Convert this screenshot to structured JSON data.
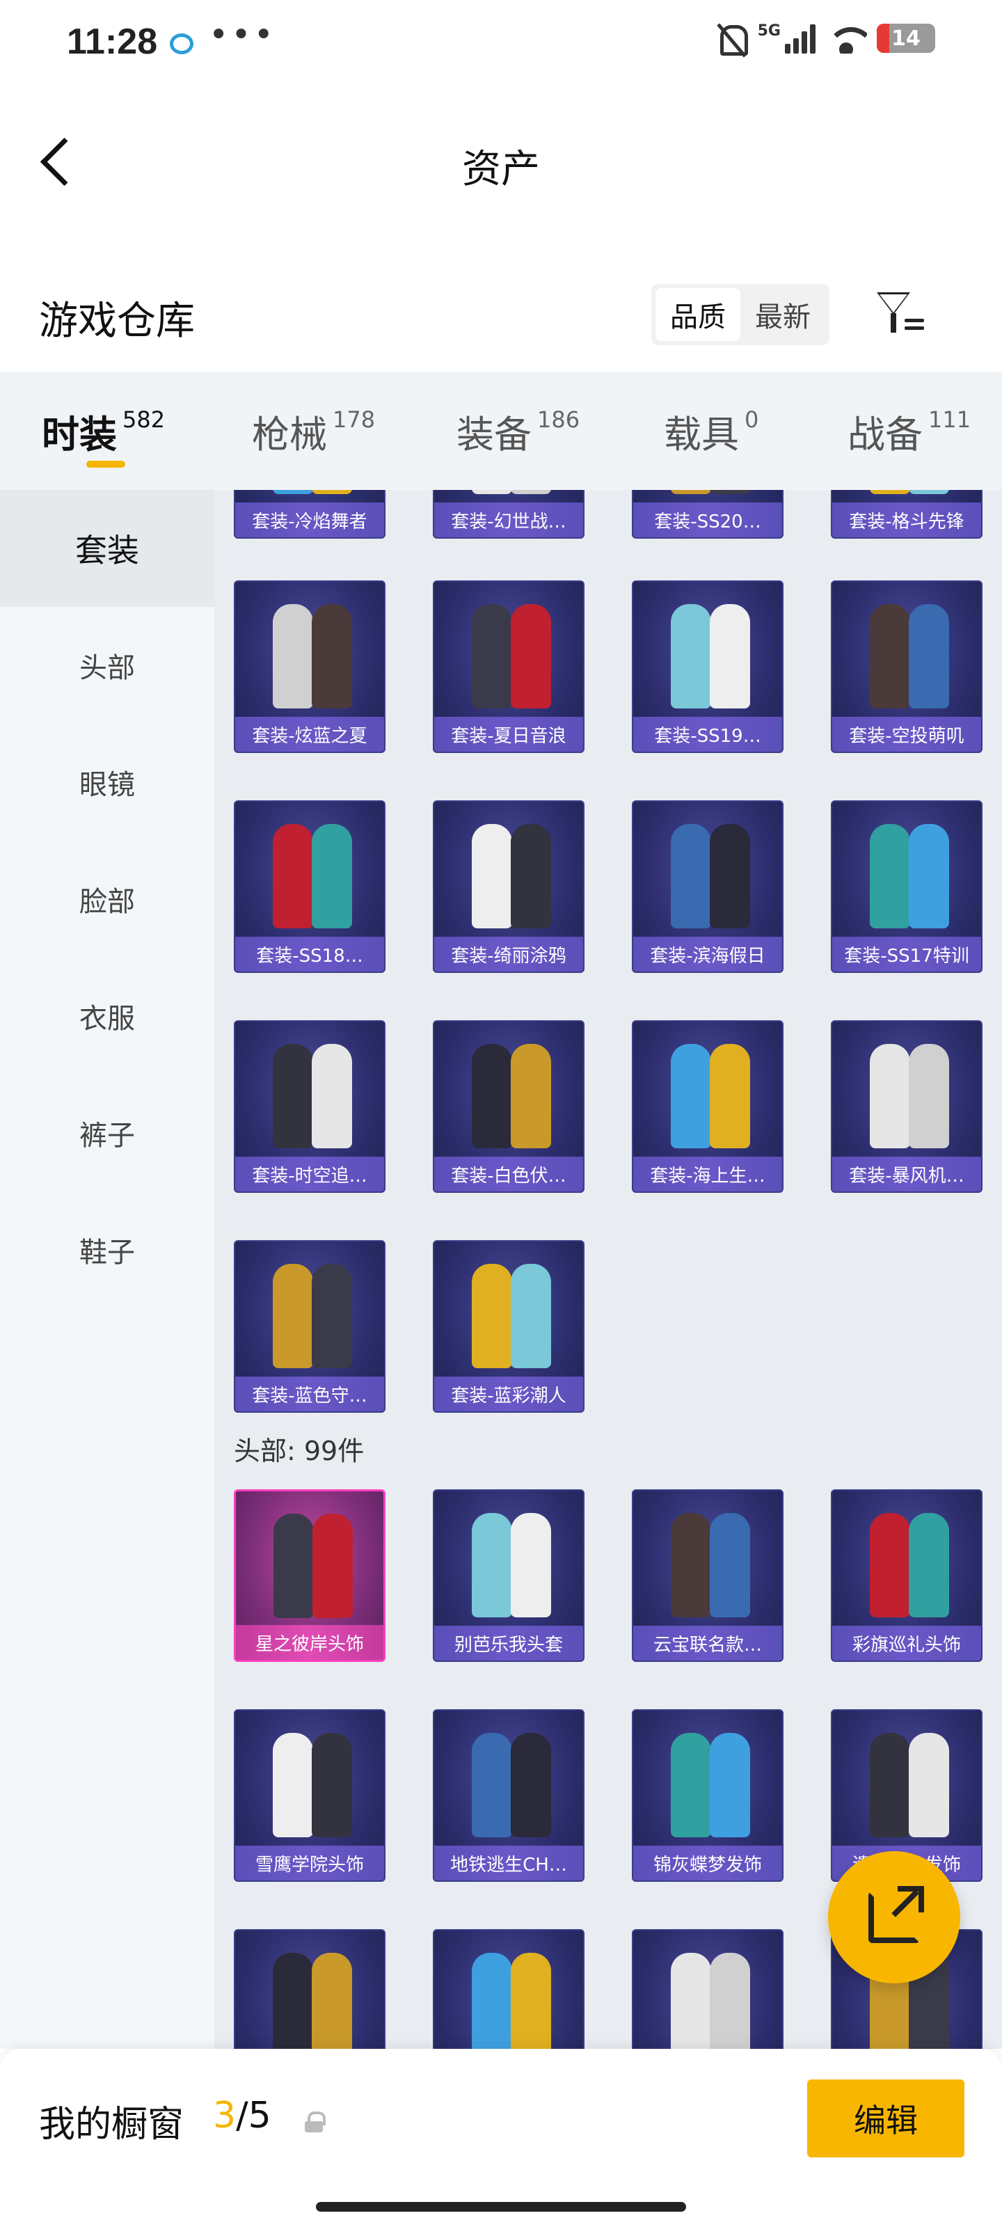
{
  "status_bar": {
    "time": "11:28",
    "network": "5G",
    "battery": "14"
  },
  "header": {
    "title": "资产"
  },
  "warehouse": {
    "title": "游戏仓库",
    "sort": [
      "品质",
      "最新"
    ]
  },
  "tabs": [
    {
      "label": "时装",
      "count": "582"
    },
    {
      "label": "枪械",
      "count": "178"
    },
    {
      "label": "装备",
      "count": "186"
    },
    {
      "label": "载具",
      "count": "0"
    },
    {
      "label": "战备",
      "count": "111"
    }
  ],
  "sidebar": [
    "套装",
    "头部",
    "眼镜",
    "脸部",
    "衣服",
    "裤子",
    "鞋子"
  ],
  "suits": [
    "套装-冷焰舞者",
    "套装-幻世战…",
    "套装-SS20…",
    "套装-格斗先锋",
    "套装-炫蓝之夏",
    "套装-夏日音浪",
    "套装-SS19…",
    "套装-空投萌叽",
    "套装-SS18…",
    "套装-绮丽涂鸦",
    "套装-滨海假日",
    "套装-SS17特训",
    "套装-时空追…",
    "套装-白色伏…",
    "套装-海上生…",
    "套装-暴风机…",
    "套装-蓝色守…",
    "套装-蓝彩潮人"
  ],
  "head_section": {
    "label": "头部: 99件"
  },
  "heads": [
    "星之彼岸头饰",
    "别芭乐我头套",
    "云宝联名款…",
    "彩旗巡礼头饰",
    "雪鹰学院头饰",
    "地铁逃生CH…",
    "锦灰蝶梦发饰",
    "遗迹…人发饰",
    "",
    "",
    "",
    ""
  ],
  "showcase": {
    "title": "我的橱窗",
    "current": "3",
    "total": "/5",
    "edit_label": "编辑"
  }
}
